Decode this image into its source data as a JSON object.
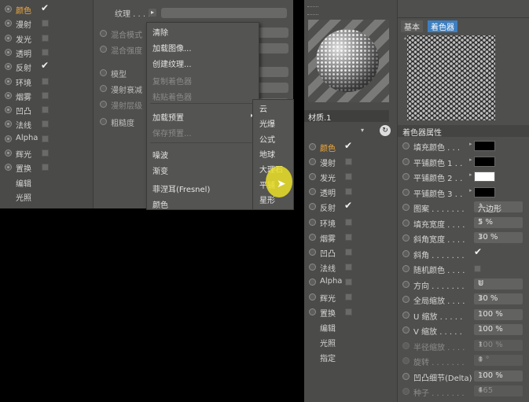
{
  "left_list": [
    {
      "label": "颜色",
      "checked": true,
      "active": true
    },
    {
      "label": "漫射",
      "checked": false
    },
    {
      "label": "发光",
      "checked": false
    },
    {
      "label": "透明",
      "checked": false
    },
    {
      "label": "反射",
      "checked": true
    },
    {
      "label": "环境",
      "checked": false
    },
    {
      "label": "烟雾",
      "checked": false
    },
    {
      "label": "凹凸",
      "checked": false
    },
    {
      "label": "法线",
      "checked": false
    },
    {
      "label": "Alpha",
      "checked": false
    },
    {
      "label": "辉光",
      "checked": false
    },
    {
      "label": "置换",
      "checked": false
    },
    {
      "label": "编辑",
      "no_check": true
    },
    {
      "label": "光照",
      "no_check": true
    }
  ],
  "left_mid": {
    "texture_label": "纹理 . . . . .",
    "rows": [
      "混合模式",
      "混合强度",
      "模型",
      "漫射衰减",
      "漫射层级",
      "粗糙度"
    ]
  },
  "context_menu": {
    "items": [
      {
        "label": "清除",
        "disabled": false
      },
      {
        "label": "加载图像...",
        "disabled": false
      },
      {
        "label": "创建纹理...",
        "disabled": false
      },
      {
        "label": "复制着色器",
        "disabled": true
      },
      {
        "label": "粘贴着色器",
        "disabled": true
      },
      {
        "label": "加载预置",
        "disabled": false,
        "submenu": true
      },
      {
        "label": "保存预置...",
        "disabled": true
      },
      {
        "label": "噪波",
        "disabled": false
      },
      {
        "label": "渐变",
        "disabled": false
      },
      {
        "label": "菲涅耳(Fresnel)",
        "disabled": false
      },
      {
        "label": "颜色",
        "disabled": false
      }
    ],
    "submenu": [
      "云",
      "光爆",
      "公式",
      "地球",
      "大理石",
      "平铺",
      "星形"
    ]
  },
  "material_name": "材质.1",
  "right_list": [
    {
      "label": "颜色",
      "checked": true,
      "active": true
    },
    {
      "label": "漫射",
      "checked": false
    },
    {
      "label": "发光",
      "checked": false
    },
    {
      "label": "透明",
      "checked": false
    },
    {
      "label": "反射",
      "checked": true
    },
    {
      "label": "环境",
      "checked": false
    },
    {
      "label": "烟雾",
      "checked": false
    },
    {
      "label": "凹凸",
      "checked": false
    },
    {
      "label": "法线",
      "checked": false
    },
    {
      "label": "Alpha",
      "checked": false
    },
    {
      "label": "辉光",
      "checked": false
    },
    {
      "label": "置换",
      "checked": false
    },
    {
      "label": "编辑",
      "no_check": true
    },
    {
      "label": "光照",
      "no_check": true
    },
    {
      "label": "指定",
      "no_check": true
    }
  ],
  "tabs": [
    "基本",
    "着色器"
  ],
  "section_header": "着色器属性",
  "props": [
    {
      "label": "填充颜色 . . .",
      "type": "swatch",
      "color": "#000000"
    },
    {
      "label": "平铺颜色 1 . .",
      "type": "swatch",
      "color": "#000000"
    },
    {
      "label": "平铺颜色 2 . .",
      "type": "swatch",
      "color": "#ffffff"
    },
    {
      "label": "平铺颜色 3 . .",
      "type": "swatch",
      "color": "#000000"
    },
    {
      "label": "图案 . . . . . . .",
      "type": "value",
      "value": "六边形"
    },
    {
      "label": "填充宽度 . . . .",
      "type": "value",
      "value": "5 %"
    },
    {
      "label": "斜角宽度 . . . .",
      "type": "value",
      "value": "30 %"
    },
    {
      "label": "斜角 . . . . . . .",
      "type": "tick"
    },
    {
      "label": "随机颜色 . . . .",
      "type": "check"
    },
    {
      "label": "方向 . . . . . . .",
      "type": "value",
      "value": "U"
    },
    {
      "label": "全局缩放 . . . .",
      "type": "value",
      "value": "30 %"
    },
    {
      "label": "U 缩放 . . . . .",
      "type": "value",
      "value": "100 %"
    },
    {
      "label": "V 缩放 . . . . .",
      "type": "value",
      "value": "100 %"
    },
    {
      "label": "半径缩放 . . . .",
      "type": "value",
      "value": "100 %",
      "dim": true
    },
    {
      "label": "旋转 . . . . . . .",
      "type": "value",
      "value": "0 °",
      "dim": true
    },
    {
      "label": "凹凸细节(Delta)",
      "type": "value",
      "value": "100 %"
    },
    {
      "label": "种子 . . . . . . .",
      "type": "value",
      "value": "665",
      "dim": true
    }
  ]
}
